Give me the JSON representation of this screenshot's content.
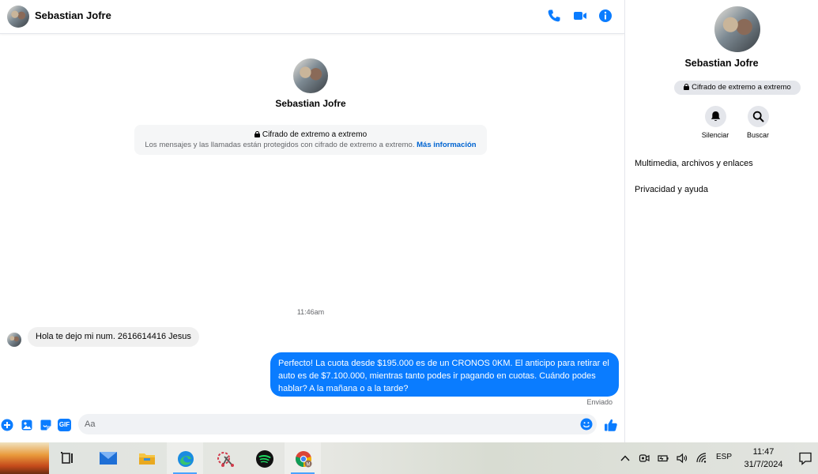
{
  "contact": {
    "name": "Sebastian Jofre"
  },
  "header": {
    "icons": [
      "phone-icon",
      "video-camera-icon",
      "info-icon"
    ]
  },
  "encryption": {
    "title": "Cifrado de extremo a extremo",
    "description": "Los mensajes y las llamadas están protegidos con cifrado de extremo a extremo.",
    "link": "Más información"
  },
  "messages": {
    "timestamp": "11:46am",
    "incoming": "Hola te dejo mi num. 2616614416 Jesus",
    "outgoing": "Perfecto! La cuota desde $195.000 es de un CRONOS 0KM. El anticipo para retirar el auto es de $7.100.000, mientras tanto podes ir pagando en cuotas. Cuándo podes hablar? A la mañana o a la tarde?",
    "status": "Enviado"
  },
  "composer": {
    "placeholder": "Aa",
    "gif_label": "GIF"
  },
  "side_panel": {
    "badge": "Cifrado de extremo a extremo",
    "actions": [
      {
        "label": "Silenciar",
        "icon": "bell-icon"
      },
      {
        "label": "Buscar",
        "icon": "search-icon"
      }
    ],
    "sections": [
      "Multimedia, archivos y enlaces",
      "Privacidad y ayuda"
    ]
  },
  "taskbar": {
    "apps": [
      "task-view-icon",
      "mail-icon",
      "file-explorer-icon",
      "edge-icon",
      "snipping-tool-icon",
      "spotify-icon",
      "chrome-icon"
    ],
    "language": "ESP",
    "time": "11:47",
    "date": "31/7/2024"
  },
  "colors": {
    "accent": "#0a7cff",
    "link": "#0064d1",
    "icon_blue": "#0a7cff"
  }
}
